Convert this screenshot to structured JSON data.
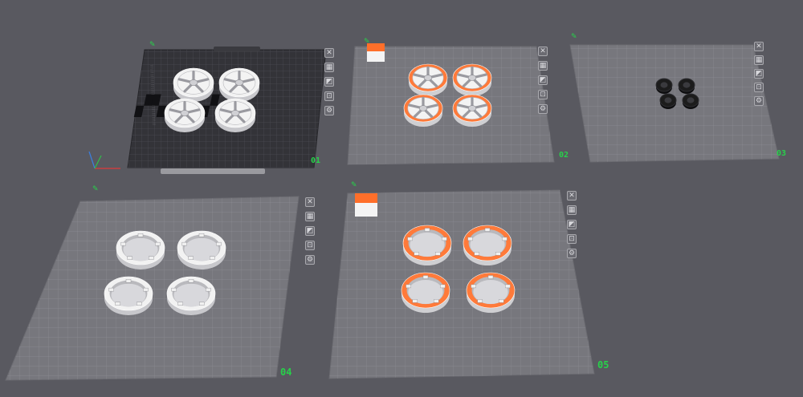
{
  "plates": [
    {
      "number": "01",
      "type": "textured",
      "color": "#3a3a3f",
      "part_color": "#f2f2f2",
      "tools": [
        "close-icon",
        "arrange-icon",
        "orient-icon",
        "lock-icon",
        "settings-icon"
      ]
    },
    {
      "number": "02",
      "type": "smooth",
      "color": "#76767c",
      "part_color": "#ff7a3a",
      "tools": [
        "close-icon",
        "arrange-icon",
        "orient-icon",
        "lock-icon",
        "settings-icon"
      ]
    },
    {
      "number": "03",
      "type": "smooth",
      "color": "#76767c",
      "part_color": "#1c1c1c",
      "tools": [
        "close-icon",
        "arrange-icon",
        "orient-icon",
        "lock-icon",
        "settings-icon"
      ]
    },
    {
      "number": "04",
      "type": "smooth",
      "color": "#76767c",
      "part_color": "#f2f2f2",
      "tools": [
        "close-icon",
        "arrange-icon",
        "orient-icon",
        "lock-icon",
        "settings-icon"
      ]
    },
    {
      "number": "05",
      "type": "smooth",
      "color": "#76767c",
      "part_color": "#ff7a3a",
      "tools": [
        "close-icon",
        "arrange-icon",
        "orient-icon",
        "lock-icon",
        "settings-icon"
      ]
    }
  ],
  "colors": {
    "background": "#595960",
    "accent_green": "#27d24a",
    "filament_orange": "#ff6f2a",
    "filament_white": "#f4f4f4",
    "filament_black": "#1a1a1a"
  }
}
